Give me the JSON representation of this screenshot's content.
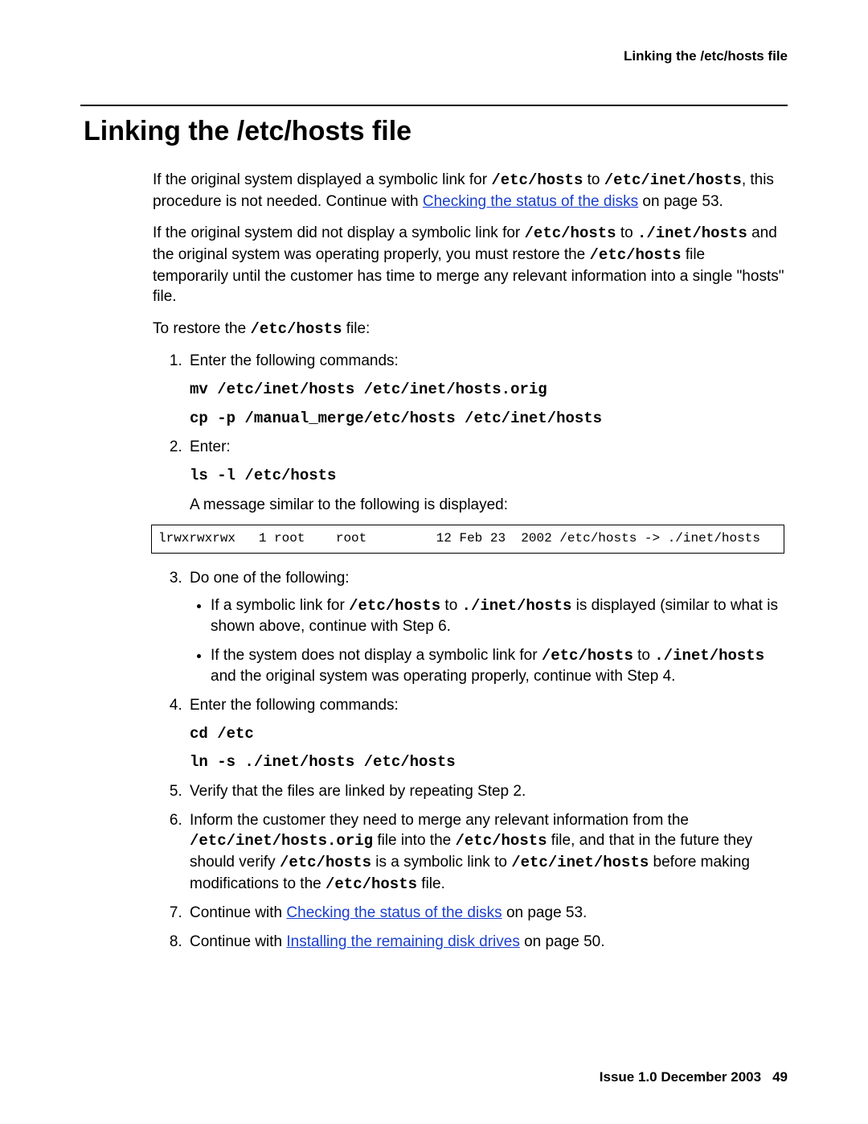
{
  "header": {
    "running": "Linking the /etc/hosts file"
  },
  "title": "Linking the /etc/hosts file",
  "intro1": {
    "pre": "If the original system displayed a symbolic link for ",
    "c1": "/etc/hosts",
    "mid1": " to ",
    "c2": "/etc/inet/hosts",
    "mid2": ", this procedure is not needed. Continue with ",
    "link": "Checking the status of the disks",
    "post": " on page 53."
  },
  "intro2": {
    "pre": "If the original system did not display a symbolic link for ",
    "c1": "/etc/hosts",
    "mid1": " to ",
    "c2": "./inet/hosts",
    "mid2": " and the original system was operating properly, you must restore the ",
    "c3": "/etc/hosts",
    "post": " file temporarily until the customer has time to merge any relevant information into a single \"hosts\" file."
  },
  "restore": {
    "pre": "To restore the ",
    "c1": "/etc/hosts",
    "post": " file:"
  },
  "step1": {
    "text": "Enter the following commands:",
    "cmd1": "mv /etc/inet/hosts /etc/inet/hosts.orig",
    "cmd2": "cp -p /manual_merge/etc/hosts /etc/inet/hosts"
  },
  "step2": {
    "text": "Enter:",
    "cmd": "ls -l /etc/hosts",
    "after": "A message similar to the following is displayed:",
    "box": "lrwxrwxrwx   1 root    root         12 Feb 23  2002 /etc/hosts -> ./inet/hosts"
  },
  "step3": {
    "text": "Do one of the following:",
    "b1": {
      "pre": "If a symbolic link for ",
      "c1": "/etc/hosts",
      "mid": " to ",
      "c2": "./inet/hosts",
      "post": " is displayed (similar to what is shown above, continue with Step 6."
    },
    "b2": {
      "pre": "If the system does not display a symbolic link for ",
      "c1": "/etc/hosts",
      "mid": " to ",
      "c2": "./inet/hosts",
      "post": " and the original system was operating properly, continue with Step 4."
    }
  },
  "step4": {
    "text": "Enter the following commands:",
    "cmd1": "cd /etc",
    "cmd2": "ln -s ./inet/hosts /etc/hosts"
  },
  "step5": {
    "text": "Verify that the files are linked by repeating Step 2."
  },
  "step6": {
    "pre": "Inform the customer they need to merge any relevant information from the ",
    "c1": "/etc/inet/hosts.orig",
    "mid1": " file into the ",
    "c2": "/etc/hosts",
    "mid2": " file, and that in the future they should verify ",
    "c3": "/etc/hosts",
    "mid3": " is a symbolic link to ",
    "c4": "/etc/inet/hosts",
    "mid4": " before making modifications to the ",
    "c5": "/etc/hosts",
    "post": " file."
  },
  "step7": {
    "pre": "Continue with ",
    "link": "Checking the status of the disks",
    "post": " on page 53."
  },
  "step8": {
    "pre": "Continue with ",
    "link": "Installing the remaining disk drives",
    "post": " on page 50."
  },
  "footer": {
    "issue": "Issue 1.0   December 2003",
    "page": "49"
  }
}
